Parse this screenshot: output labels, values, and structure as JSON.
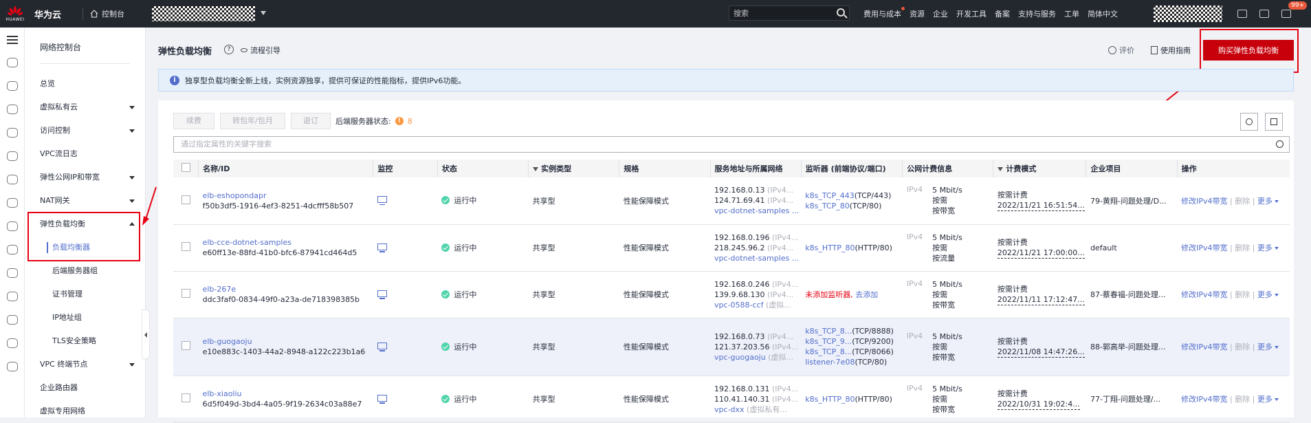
{
  "topbar": {
    "logo_text": "HUAWEI",
    "brand": "华为云",
    "console": "控制台",
    "search_placeholder": "搜索",
    "nav": [
      "费用与成本",
      "资源",
      "企业",
      "开发工具",
      "备案",
      "支持与服务",
      "工单",
      "简体中文"
    ],
    "badge": "99+"
  },
  "sidebar": {
    "title": "网络控制台",
    "items": [
      {
        "label": "总览"
      },
      {
        "label": "虚拟私有云"
      },
      {
        "label": "访问控制"
      },
      {
        "label": "VPC流日志"
      },
      {
        "label": "弹性公网IP和带宽"
      },
      {
        "label": "NAT网关"
      },
      {
        "label": "弹性负载均衡"
      },
      {
        "label": "负载均衡器"
      },
      {
        "label": "后端服务器组"
      },
      {
        "label": "证书管理"
      },
      {
        "label": "IP地址组"
      },
      {
        "label": "TLS安全策略"
      },
      {
        "label": "VPC 终端节点"
      },
      {
        "label": "企业路由器"
      },
      {
        "label": "虚拟专用网络"
      }
    ]
  },
  "header": {
    "title": "弹性负载均衡",
    "flow_guide": "流程引导",
    "rate": "评价",
    "guide": "使用指南",
    "buy_button": "购买弹性负载均衡"
  },
  "notice": {
    "text": "独享型负载均衡全新上线，实例资源独享，提供可保证的性能指标，提供IPv6功能。"
  },
  "toolbar": {
    "renew": "续费",
    "convert": "转包年/包月",
    "unsubscribe": "退订",
    "backend_status_label": "后端服务器状态:",
    "backend_status_count": "8",
    "filter_placeholder": "通过指定属性的关键字搜索"
  },
  "table": {
    "headers": [
      "名称/ID",
      "监控",
      "状态",
      "实例类型",
      "规格",
      "服务地址与所属网络",
      "监听器 (前端协议/端口)",
      "公网计费信息",
      "计费模式",
      "企业项目",
      "操作"
    ],
    "rows": [
      {
        "name": "elb-eshopondapr",
        "id": "f50b3df5-1916-4ef3-8251-4dcfff58b507",
        "status": "运行中",
        "type": "共享型",
        "spec": "性能保障模式",
        "addr1": "192.168.0.13",
        "addr1_suffix": "(IPv4...",
        "addr2": "124.71.69.41",
        "addr2_suffix": "(IPv4...",
        "vpc": "vpc-dotnet-samples ...",
        "vpc_suffix": "",
        "listeners": [
          {
            "name": "k8s_TCP_443",
            "proto": "(TCP/443)"
          },
          {
            "name": "k8s_TCP_80",
            "proto": "(TCP/80)"
          }
        ],
        "ip_type": "IPv4",
        "bw": [
          "5 Mbit/s",
          "按需",
          "按带宽"
        ],
        "billing": "按需计费",
        "billing_time": "2022/11/21 16:51:54...",
        "project": "79-黄翔-问题处理/D...",
        "op1": "修改IPv4带宽",
        "op2": "删除",
        "op3": "更多"
      },
      {
        "name": "elb-cce-dotnet-samples",
        "id": "e60ff13e-88fd-41b0-bfc6-87941cd464d5",
        "status": "运行中",
        "type": "共享型",
        "spec": "性能保障模式",
        "addr1": "192.168.0.196",
        "addr1_suffix": "(IPv4...",
        "addr2": "218.245.96.2",
        "addr2_suffix": "(IPv4...",
        "vpc": "vpc-dotnet-samples ...",
        "vpc_suffix": "",
        "listeners": [
          {
            "name": "k8s_HTTP_80",
            "proto": "(HTTP/80)"
          }
        ],
        "ip_type": "IPv4",
        "bw": [
          "5 Mbit/s",
          "按需",
          "按流量"
        ],
        "billing": "按需计费",
        "billing_time": "2022/11/21 17:00:00...",
        "project": "default",
        "op1": "修改IPv4带宽",
        "op2": "删除",
        "op3": "更多"
      },
      {
        "name": "elb-267e",
        "id": "ddc3faf0-0834-49f0-a23a-de718398385b",
        "status": "运行中",
        "type": "共享型",
        "spec": "性能保障模式",
        "addr1": "192.168.0.246",
        "addr1_suffix": "(IPv4...",
        "addr2": "139.9.68.130",
        "addr2_suffix": "(IPv4...",
        "vpc": "vpc-0588-ccf",
        "vpc_suffix": "(虚拟...",
        "listeners": [],
        "no_listener": "未添加监听器,",
        "add_listener": "去添加",
        "ip_type": "IPv4",
        "bw": [
          "5 Mbit/s",
          "按需",
          "按带宽"
        ],
        "billing": "按需计费",
        "billing_time": "2022/11/11 17:12:47...",
        "project": "87-蔡春福-问题处理...",
        "op1": "修改IPv4带宽",
        "op2": "删除",
        "op3": "更多"
      },
      {
        "name": "elb-guogaoju",
        "id": "e10e883c-1403-44a2-8948-a122c223b1a6",
        "status": "运行中",
        "type": "共享型",
        "spec": "性能保障模式",
        "addr1": "192.168.0.73",
        "addr1_suffix": "(IPv4...",
        "addr2": "121.37.203.56",
        "addr2_suffix": "(IPv4...",
        "vpc": "vpc-guogaoju",
        "vpc_suffix": "(虚拟...",
        "listeners": [
          {
            "name": "k8s_TCP_8...",
            "proto": "(TCP/8888)"
          },
          {
            "name": "k8s_TCP_9...",
            "proto": "(TCP/9200)"
          },
          {
            "name": "k8s_TCP_8...",
            "proto": "(TCP/8066)"
          },
          {
            "name": "listener-7e08",
            "proto": "(TCP/80)"
          }
        ],
        "ip_type": "IPv4",
        "bw": [
          "5 Mbit/s",
          "按需",
          "按带宽"
        ],
        "billing": "按需计费",
        "billing_time": "2022/11/08 14:47:26...",
        "project": "88-郭高举-问题处理...",
        "op1": "修改IPv4带宽",
        "op2": "删除",
        "op3": "更多"
      },
      {
        "name": "elb-xiaoliu",
        "id": "6d5f049d-3bd4-4a05-9f19-2634c03a88e7",
        "status": "运行中",
        "type": "共享型",
        "spec": "性能保障模式",
        "addr1": "192.168.0.131",
        "addr1_suffix": "(IPv4...",
        "addr2": "110.41.140.31",
        "addr2_suffix": "(IPv4...",
        "vpc": "vpc-dxx",
        "vpc_suffix": "(虚拟私有...",
        "listeners": [
          {
            "name": "k8s_HTTP_80",
            "proto": "(HTTP/80)"
          }
        ],
        "ip_type": "IPv4",
        "bw": [
          "5 Mbit/s",
          "按需",
          "按带宽"
        ],
        "billing": "按需计费",
        "billing_time": "2022/10/31 19:02:4...",
        "project": "77-丁翔-问题处理/...",
        "op1": "修改IPv4带宽",
        "op2": "删除",
        "op3": "更多"
      }
    ]
  },
  "colors": {
    "topbar": "#23272e",
    "accent": "#526ecc",
    "buy_button": "#c7000b",
    "highlight_box": "#e60012",
    "running": "#50d4ab"
  }
}
